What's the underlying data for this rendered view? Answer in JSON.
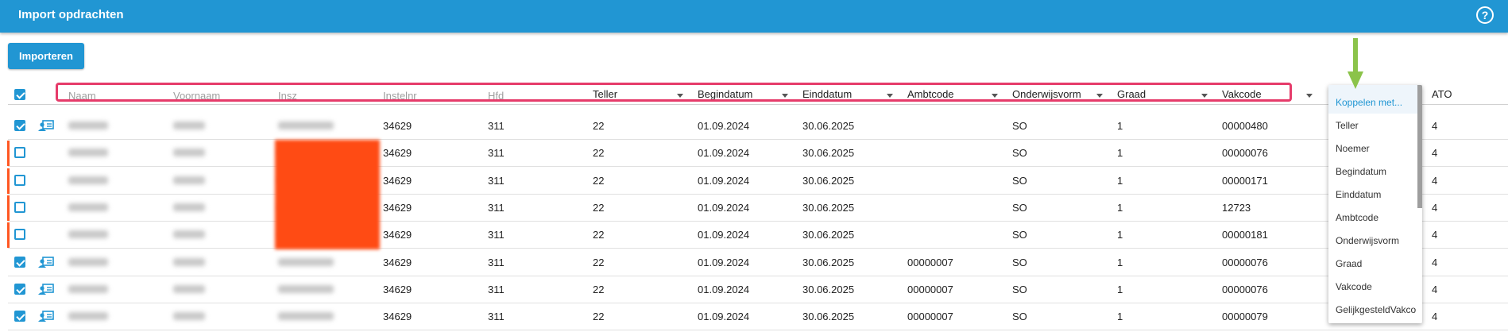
{
  "window": {
    "title": "Import opdrachten",
    "help_icon": "?"
  },
  "toolbar": {
    "import_label": "Importeren"
  },
  "columns": {
    "naam": "Naam",
    "voornaam": "Voornaam",
    "insz": "Insz",
    "instelnr": "Instelnr",
    "hfd": "Hfd",
    "teller": "Teller",
    "begindatum": "Begindatum",
    "einddatum": "Einddatum",
    "ambtcode": "Ambtcode",
    "onderwijsvorm": "Onderwijsvorm",
    "graad": "Graad",
    "vakcode": "Vakcode",
    "ato": "ATO"
  },
  "rows": [
    {
      "checked": true,
      "instelnr": "34629",
      "hfd": "311",
      "teller": "22",
      "begindatum": "01.09.2024",
      "einddatum": "30.06.2025",
      "ambtcode": "",
      "onderwijsvorm": "SO",
      "graad": "1",
      "vakcode": "00000480",
      "ato": "4"
    },
    {
      "checked": false,
      "instelnr": "34629",
      "hfd": "311",
      "teller": "22",
      "begindatum": "01.09.2024",
      "einddatum": "30.06.2025",
      "ambtcode": "",
      "onderwijsvorm": "SO",
      "graad": "1",
      "vakcode": "00000076",
      "ato": "4"
    },
    {
      "checked": false,
      "instelnr": "34629",
      "hfd": "311",
      "teller": "22",
      "begindatum": "01.09.2024",
      "einddatum": "30.06.2025",
      "ambtcode": "",
      "onderwijsvorm": "SO",
      "graad": "1",
      "vakcode": "00000171",
      "ato": "4"
    },
    {
      "checked": false,
      "instelnr": "34629",
      "hfd": "311",
      "teller": "22",
      "begindatum": "01.09.2024",
      "einddatum": "30.06.2025",
      "ambtcode": "",
      "onderwijsvorm": "SO",
      "graad": "1",
      "vakcode": "12723",
      "ato": "4"
    },
    {
      "checked": false,
      "instelnr": "34629",
      "hfd": "311",
      "teller": "22",
      "begindatum": "01.09.2024",
      "einddatum": "30.06.2025",
      "ambtcode": "",
      "onderwijsvorm": "SO",
      "graad": "1",
      "vakcode": "00000181",
      "ato": "4"
    },
    {
      "checked": true,
      "instelnr": "34629",
      "hfd": "311",
      "teller": "22",
      "begindatum": "01.09.2024",
      "einddatum": "30.06.2025",
      "ambtcode": "00000007",
      "onderwijsvorm": "SO",
      "graad": "1",
      "vakcode": "00000076",
      "ato": "4"
    },
    {
      "checked": true,
      "instelnr": "34629",
      "hfd": "311",
      "teller": "22",
      "begindatum": "01.09.2024",
      "einddatum": "30.06.2025",
      "ambtcode": "00000007",
      "onderwijsvorm": "SO",
      "graad": "1",
      "vakcode": "00000076",
      "ato": "4"
    },
    {
      "checked": true,
      "instelnr": "34629",
      "hfd": "311",
      "teller": "22",
      "begindatum": "01.09.2024",
      "einddatum": "30.06.2025",
      "ambtcode": "00000007",
      "onderwijsvorm": "SO",
      "graad": "1",
      "vakcode": "00000079",
      "ato": "4"
    }
  ],
  "column_menu": {
    "items": [
      "Koppelen met...",
      "Teller",
      "Noemer",
      "Begindatum",
      "Einddatum",
      "Ambtcode",
      "Onderwijsvorm",
      "Graad",
      "Vakcode",
      "GelijkgesteldVakco"
    ]
  },
  "colors": {
    "accent": "#2196d3",
    "highlight": "#e63b6a",
    "warning": "#ff5722",
    "pointer": "#8bc34a"
  }
}
